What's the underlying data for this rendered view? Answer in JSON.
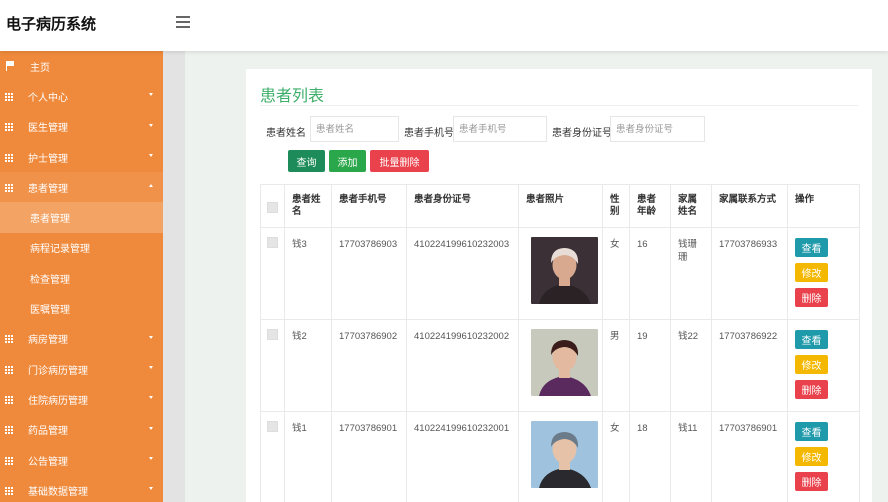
{
  "app": {
    "title": "电子病历系统"
  },
  "sidebar": {
    "items": [
      {
        "label": "主页",
        "icon": "flag-icon",
        "chevron": "none"
      },
      {
        "label": "个人中心",
        "icon": "grid-icon",
        "chevron": "down"
      },
      {
        "label": "医生管理",
        "icon": "grid-icon",
        "chevron": "down"
      },
      {
        "label": "护士管理",
        "icon": "grid-icon",
        "chevron": "down"
      },
      {
        "label": "患者管理",
        "icon": "grid-icon",
        "chevron": "up",
        "open": true,
        "children": [
          "患者管理",
          "病程记录管理",
          "检查管理",
          "医嘱管理"
        ]
      },
      {
        "label": "病房管理",
        "icon": "grid-icon",
        "chevron": "down"
      },
      {
        "label": "门诊病历管理",
        "icon": "grid-icon",
        "chevron": "down"
      },
      {
        "label": "住院病历管理",
        "icon": "grid-icon",
        "chevron": "down"
      },
      {
        "label": "药品管理",
        "icon": "grid-icon",
        "chevron": "down"
      },
      {
        "label": "公告管理",
        "icon": "grid-icon",
        "chevron": "down"
      },
      {
        "label": "基础数据管理",
        "icon": "grid-icon",
        "chevron": "down"
      }
    ]
  },
  "main": {
    "title": "患者列表",
    "search": {
      "name_label": "患者姓名",
      "name_placeholder": "患者姓名",
      "phone_label": "患者手机号",
      "phone_placeholder": "患者手机号",
      "idcard_label": "患者身份证号",
      "idcard_placeholder": "患者身份证号"
    },
    "buttons": {
      "query": "查询",
      "add": "添加",
      "batch_delete": "批量删除"
    },
    "table": {
      "headers": [
        "患者姓名",
        "患者手机号",
        "患者身份证号",
        "患者照片",
        "性别",
        "患者年龄",
        "家属姓名",
        "家属联系方式",
        "操作"
      ],
      "row_actions": {
        "view": "查看",
        "edit": "修改",
        "delete": "删除"
      },
      "rows": [
        {
          "name": "钱3",
          "phone": "17703786903",
          "idcard": "410224199610232003",
          "gender": "女",
          "age": "16",
          "family_name": "钱珊珊",
          "family_phone": "17703786933",
          "photo_palette": [
            "#3a3036",
            "#d9a98f",
            "#2b2226",
            "#e8dcd6"
          ]
        },
        {
          "name": "钱2",
          "phone": "17703786902",
          "idcard": "410224199610232002",
          "gender": "男",
          "age": "19",
          "family_name": "钱22",
          "family_phone": "17703786922",
          "photo_palette": [
            "#c8c9bd",
            "#e3b9a0",
            "#5a2a5e",
            "#3a1d1b"
          ]
        },
        {
          "name": "钱1",
          "phone": "17703786901",
          "idcard": "410224199610232001",
          "gender": "女",
          "age": "18",
          "family_name": "钱11",
          "family_phone": "17703786901",
          "photo_palette": [
            "#9fc3de",
            "#e6c2a8",
            "#2a2a2e",
            "#6c7b8a"
          ]
        }
      ]
    }
  }
}
